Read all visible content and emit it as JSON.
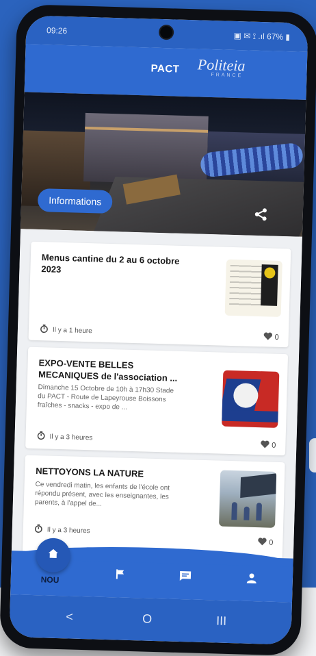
{
  "status_bar": {
    "time": "09:26",
    "indicators": "▣ ✉ ⟟ .ıl 67% ▮"
  },
  "header": {
    "title": "PACT",
    "brand_main": "Politeia",
    "brand_sub": "FRANCE"
  },
  "hero": {
    "category_chip": "Informations",
    "icons": [
      "share-icon"
    ]
  },
  "feed": {
    "items": [
      {
        "title": "Menus cantine du 2 au 6 octobre 2023",
        "description": "",
        "time": "Il y a 1 heure",
        "likes": "0",
        "thumbnail": "menu-poster"
      },
      {
        "title": "EXPO-VENTE BELLES MECANIQUES de l'association ...",
        "description": "Dimanche 15 Octobre de 10h à 17h30 Stade du PACT - Route de Lapeyrouse Boissons fraîches - snacks - expo de ...",
        "time": "Il y a 3 heures",
        "likes": "0",
        "thumbnail": "expo-vente-poster"
      },
      {
        "title": "NETTOYONS LA NATURE",
        "description": "Ce vendredi matin, les enfants de l'école ont répondu présent, avec les enseignantes, les parents, à l'appel de...",
        "time": "Il y a 3 heures",
        "likes": "0",
        "thumbnail": "school-photo"
      }
    ]
  },
  "bottom_nav": {
    "home_label": "NOU",
    "items": [
      "home-icon",
      "flag-icon",
      "message-icon",
      "person-icon"
    ]
  },
  "system_nav": {
    "back": "<",
    "home": "O",
    "recents": "III"
  },
  "colors": {
    "primary": "#2f6ad0",
    "background": "#2b63bd",
    "card": "#ffffff"
  }
}
